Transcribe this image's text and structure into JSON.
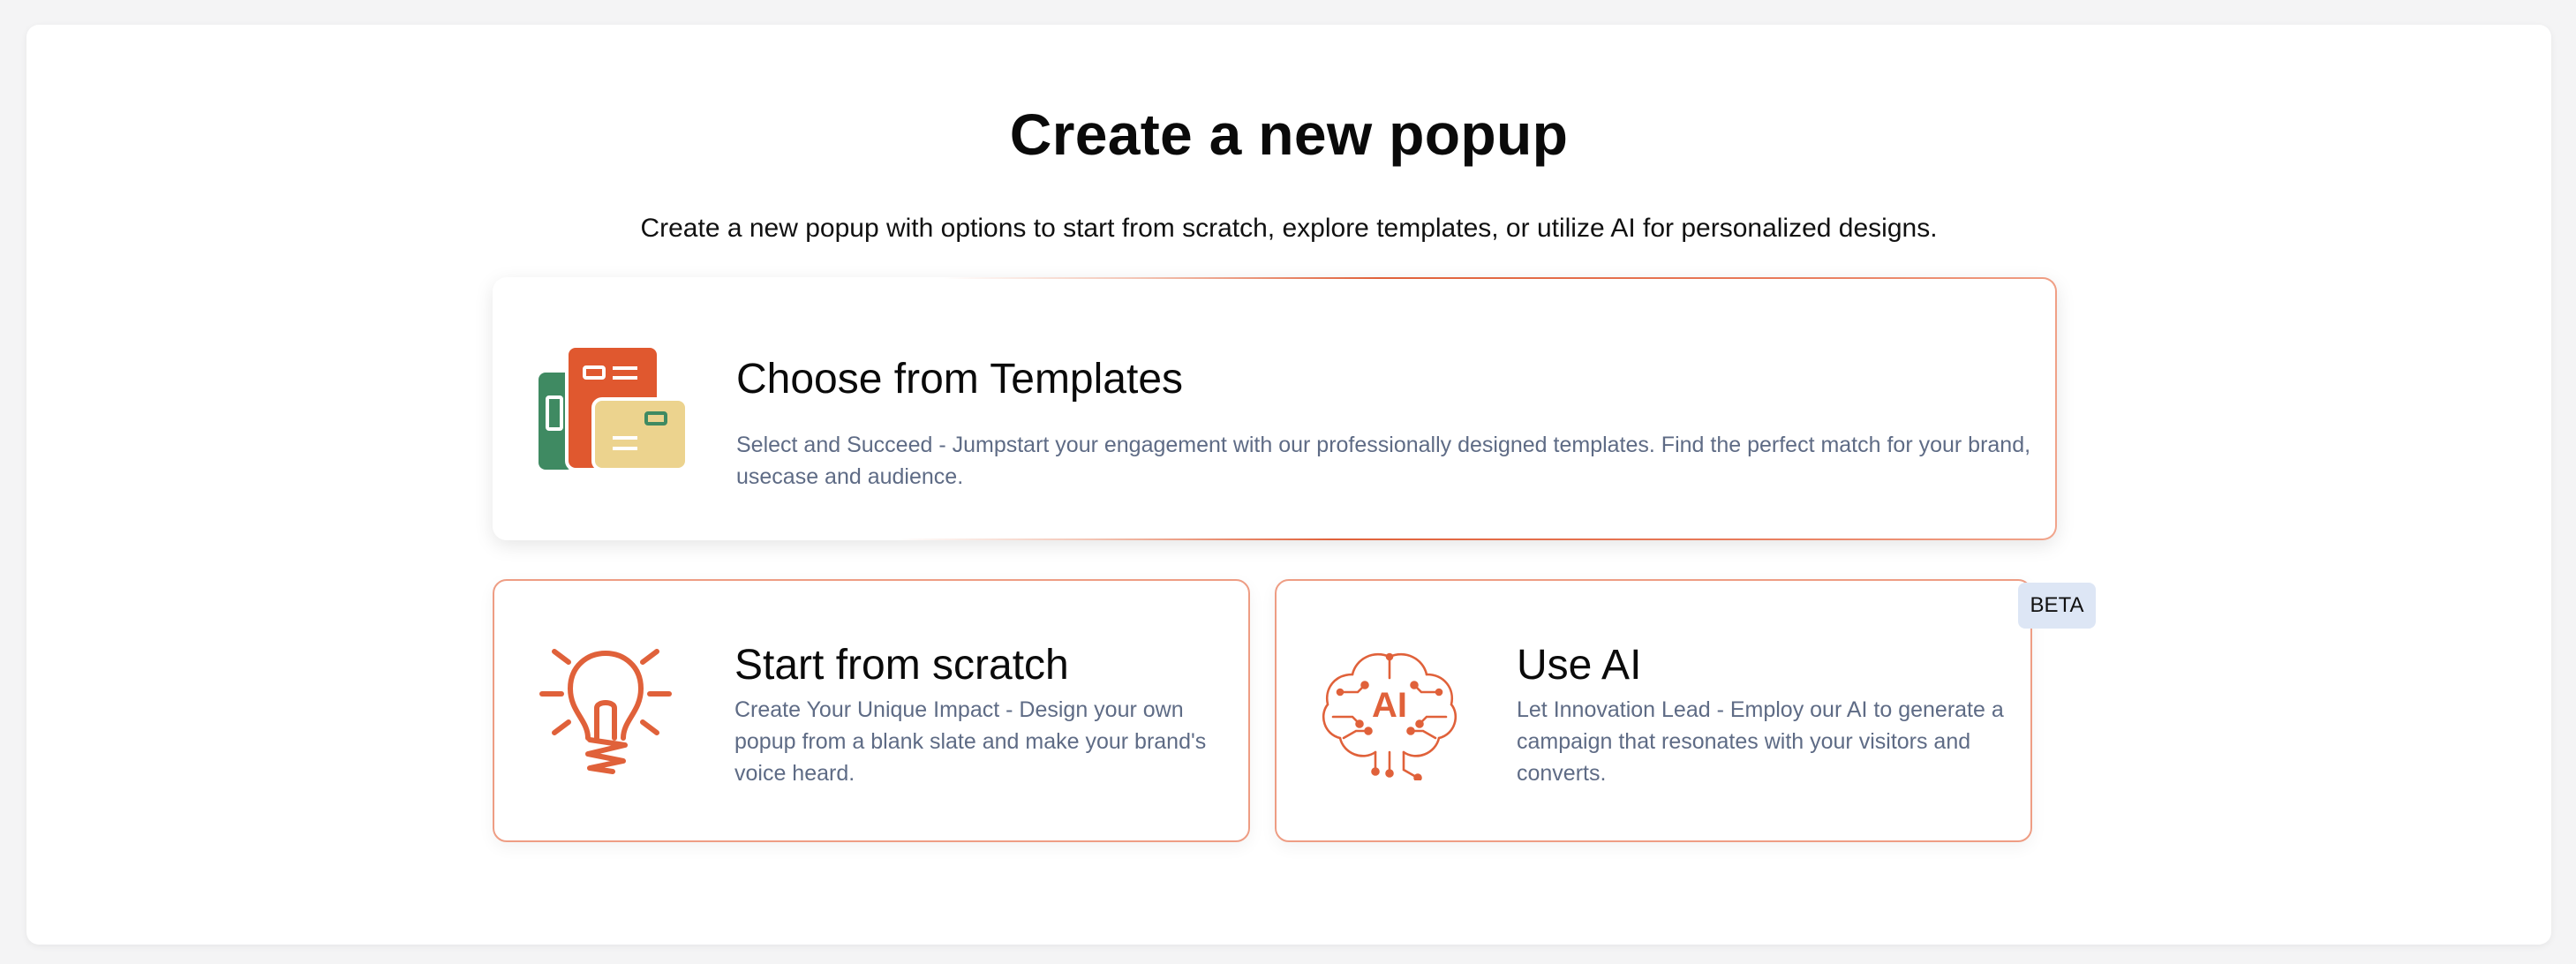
{
  "page": {
    "title": "Create a new popup",
    "subtitle": "Create a new popup with options to start from scratch, explore templates, or utilize AI for personalized designs."
  },
  "cards": {
    "templates": {
      "icon": "templates-icon",
      "title": "Choose from Templates",
      "description": "Select and Succeed - Jumpstart your engagement with our professionally designed templates. Find the perfect match for your brand, usecase and audience."
    },
    "scratch": {
      "icon": "lightbulb-icon",
      "title": "Start from scratch",
      "description": "Create Your Unique Impact - Design your own popup from a blank slate and make your brand's voice heard."
    },
    "ai": {
      "icon": "ai-brain-icon",
      "title": "Use AI",
      "description": "Let Innovation Lead - Employ our AI to generate a campaign that resonates with your visitors and converts.",
      "badge": "BETA",
      "icon_text": "AI"
    }
  },
  "colors": {
    "accent": "#e0613a",
    "border": "#ee9d84",
    "description_text": "#5e6b85",
    "badge_bg": "#dde6f5",
    "template_green": "#3f8a62",
    "template_orange": "#e0582f",
    "template_sand": "#ecd38e"
  }
}
